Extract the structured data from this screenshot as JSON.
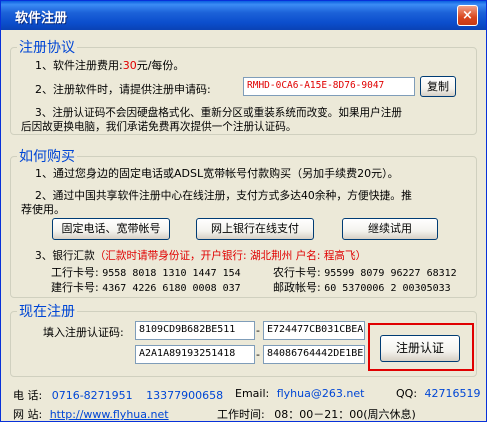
{
  "window": {
    "title": "软件注册",
    "close_glyph": "×"
  },
  "agreement": {
    "legend": "注册协议",
    "line1_pre": "1、软件注册费用:",
    "line1_fee": "30",
    "line1_post": "元/每份。",
    "line2": "2、注册软件时，请提供注册申请码:",
    "request_code": "RMHD-0CA6-A15E-8D76-9047",
    "copy_button": "复制",
    "line3a": "3、注册认证码不会因硬盘格式化、重新分区或重装系统而改变。如果用户注册",
    "line3b": "后因故更换电脑，我们承诺免费再次提供一个注册认证码。"
  },
  "purchase": {
    "legend": "如何购买",
    "line1": "1、通过您身边的固定电话或ADSL宽带帐号付款购买（另加手续费20元）。",
    "line2a": "2、通过中国共享软件注册中心在线注册，支付方式多达40余种，方便快捷。推",
    "line2b": "荐使用。",
    "btn_phone": "固定电话、宽带帐号",
    "btn_online": "网上银行在线支付",
    "btn_trial": "继续试用",
    "bank_label": "3、银行汇款",
    "bank_note": "（汇款时请带身份证，开户银行: 湖北荆州 户名: 程高飞）",
    "banks": [
      {
        "name": "工行卡号:",
        "number": "9558 8018 1310 1447 154"
      },
      {
        "name": "农行卡号:",
        "number": "95599 8079 96227 68312"
      },
      {
        "name": "建行卡号:",
        "number": "4367 4226 6180 0008 037"
      },
      {
        "name": "邮政帐号:",
        "number": "60 5370006 2 00305033"
      }
    ]
  },
  "register": {
    "legend": "现在注册",
    "label": "填入注册认证码:",
    "code_parts": [
      "8109CD9B682BE511",
      "E724477CB031CBEA",
      "A2A1A89193251418",
      "84086764442DE1BE"
    ],
    "dash": "-",
    "button": "注册认证"
  },
  "footer": {
    "phone_label": "电  话:",
    "phone1": "0716-8271951",
    "phone2": "13377900658",
    "email_label": "Email:",
    "email": "flyhua@263.net",
    "qq_label": "QQ:",
    "qq": "42716519",
    "site_label": "网  站:",
    "site": "http://www.flyhua.net",
    "hours_label": "工作时间:",
    "hours": "08：00－21：00(周六休息)"
  },
  "colors": {
    "accent": "#0046d5",
    "highlight": "#e00000",
    "face": "#ece9d8"
  }
}
